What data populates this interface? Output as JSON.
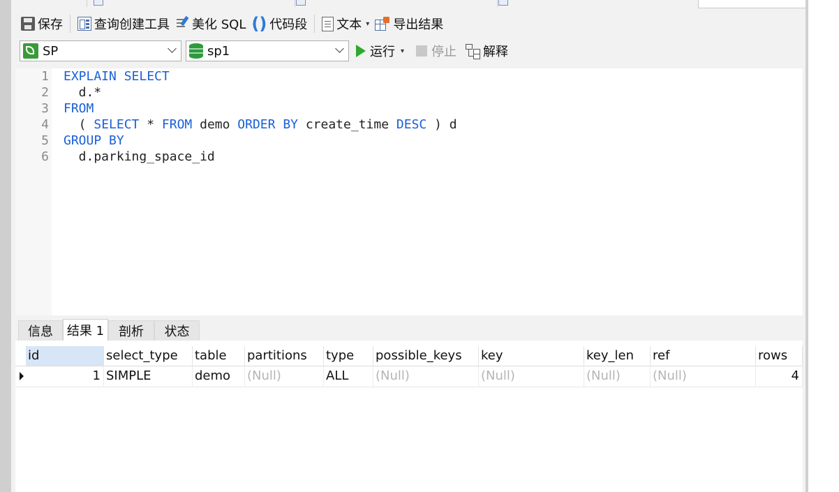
{
  "toolbar": {
    "save_label": "保存",
    "query_builder_label": "查询创建工具",
    "beautify_label": "美化 SQL",
    "snippet_label": "代码段",
    "text_label": "文本",
    "export_label": "导出结果"
  },
  "connection_bar": {
    "connection_value": "SP",
    "database_value": "sp1",
    "run_label": "运行",
    "stop_label": "停止",
    "explain_label": "解释"
  },
  "editor": {
    "lines": [
      {
        "num": "1",
        "tokens": [
          {
            "t": "EXPLAIN SELECT",
            "kw": true
          }
        ]
      },
      {
        "num": "2",
        "tokens": [
          {
            "t": "  d.*",
            "kw": false
          }
        ]
      },
      {
        "num": "3",
        "tokens": [
          {
            "t": "FROM",
            "kw": true
          }
        ]
      },
      {
        "num": "4",
        "tokens": [
          {
            "t": "  ( ",
            "kw": false
          },
          {
            "t": "SELECT",
            "kw": true
          },
          {
            "t": " * ",
            "kw": false
          },
          {
            "t": "FROM",
            "kw": true
          },
          {
            "t": " demo ",
            "kw": false
          },
          {
            "t": "ORDER BY",
            "kw": true
          },
          {
            "t": " create_time ",
            "kw": false
          },
          {
            "t": "DESC",
            "kw": true
          },
          {
            "t": " ) d",
            "kw": false
          }
        ]
      },
      {
        "num": "5",
        "tokens": [
          {
            "t": "GROUP BY",
            "kw": true
          }
        ]
      },
      {
        "num": "6",
        "tokens": [
          {
            "t": "  d.parking_space_id",
            "kw": false
          }
        ]
      }
    ]
  },
  "result_tabs": [
    "信息",
    "结果 1",
    "剖析",
    "状态"
  ],
  "active_result_tab": "结果 1",
  "grid": {
    "columns": [
      "id",
      "select_type",
      "table",
      "partitions",
      "type",
      "possible_keys",
      "key",
      "key_len",
      "ref",
      "rows"
    ],
    "rows": [
      [
        "1",
        "SIMPLE",
        "demo",
        "(Null)",
        "ALL",
        "(Null)",
        "(Null)",
        "(Null)",
        "(Null)",
        "4"
      ]
    ]
  },
  "colors": {
    "keyword": "#1a5fd8",
    "null_text": "#b5b5b5",
    "run_green": "#2fa82f",
    "selected_header": "#d7e6f7"
  }
}
